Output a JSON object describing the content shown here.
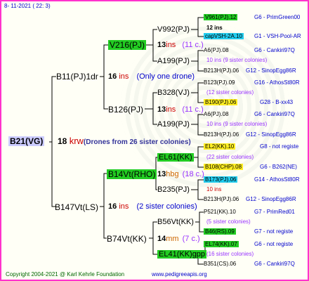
{
  "header": {
    "date": "8- 11-2021 ( 22: 3)"
  },
  "footer": {
    "copyright": "Copyright 2004-2021 @ Karl Kehrle Foundation",
    "site": "www.pedigreeapis.org"
  },
  "root": {
    "name": "B21(VG)",
    "count": "18",
    "unit": "krw",
    "note": "(Drones from 26 sister colonies)"
  },
  "gen1": [
    {
      "name": "B11(PJ)1dr",
      "count": "16",
      "unit": "ins",
      "note": "(Only one drone)"
    },
    {
      "name": "B147Vt(LS)",
      "count": "16",
      "unit": "ins",
      "note": "(2 sister colonies)"
    }
  ],
  "gen2": [
    {
      "name": "V216(PJ)",
      "count": "13",
      "unit": "ins",
      "note": "(11 c.)"
    },
    {
      "name": "B126(PJ)",
      "count": "13",
      "unit": "ins",
      "note": "(11 c.)"
    },
    {
      "name": "B14Vt(RHO)",
      "count": "13",
      "unit": "hbg",
      "note": "(18 c.)"
    },
    {
      "name": "B74Vt(KK)",
      "count": "14",
      "unit": "mm",
      "note": "(7 c.)"
    }
  ],
  "gen3": [
    {
      "name": "V992(PJ)",
      "count": "12",
      "unit": "ins",
      "note": ""
    },
    {
      "name": "A199(PJ)",
      "count": "",
      "unit": "",
      "note": ""
    },
    {
      "name": "B328(VJ)",
      "count": "11",
      "unit": "ins",
      "note": "(12 sister colonies)"
    },
    {
      "name": "A199(PJ)",
      "count": "",
      "unit": "",
      "note": ""
    },
    {
      "name": "EL61(KK)",
      "count": "11",
      "unit": "hb",
      "note": "(22 sister colonies)"
    },
    {
      "name": "B235(PJ)",
      "count": "",
      "unit": "",
      "note": ""
    },
    {
      "name": "B56Vt(KK)",
      "count": "12",
      "unit": "hb",
      "note": "(5 sister colonies)"
    },
    {
      "name": "EL41(KK)gpp",
      "count": "09",
      "unit": "hb",
      "note": "(16 sister colonies)"
    }
  ],
  "gen4": [
    {
      "name": "V961(PJ).12",
      "info": "G6 - PrimGreen00"
    },
    {
      "name": "12 ins",
      "info": ""
    },
    {
      "name": "capVSH-2A.10",
      "info": "G1 - VSH-Pool-AR"
    },
    {
      "name": "A6(PJ).08",
      "info": "G6 - Cankiri97Q"
    },
    {
      "name": "10 ins (9 sister colonies)",
      "info": ""
    },
    {
      "name": "B213H(PJ).06",
      "info": "G12 - SinopEgg86R"
    },
    {
      "name": "B123(PJ).09",
      "info": "G16 - AthosSt80R"
    },
    {
      "name": "B190(PJ).06",
      "info": "G28 - B-xx43"
    },
    {
      "name": "A6(PJ).08",
      "info": "G6 - Cankiri97Q"
    },
    {
      "name": "10 ins (9 sister colonies)",
      "info": ""
    },
    {
      "name": "B213H(PJ).06",
      "info": "G12 - SinopEgg86R"
    },
    {
      "name": "EL2(KK).10",
      "info": "G8 - not registe"
    },
    {
      "name": "B108(CHP).08",
      "info": "G6 - B262(NE)"
    },
    {
      "name": "B173(PJ).06",
      "info": "G14 - AthosSt80R"
    },
    {
      "name": "10 ins",
      "info": ""
    },
    {
      "name": "B213H(PJ).06",
      "info": "G12 - SinopEgg86R"
    },
    {
      "name": "P521(KK).10",
      "info": "G7 - PrimRed01"
    },
    {
      "name": "B46(RS).09",
      "info": "G7 - not registe"
    },
    {
      "name": "EL74(KK).07",
      "info": "G6 - not registe"
    },
    {
      "name": "B351(CS).06",
      "info": "G6 - Cankiri97Q"
    }
  ]
}
